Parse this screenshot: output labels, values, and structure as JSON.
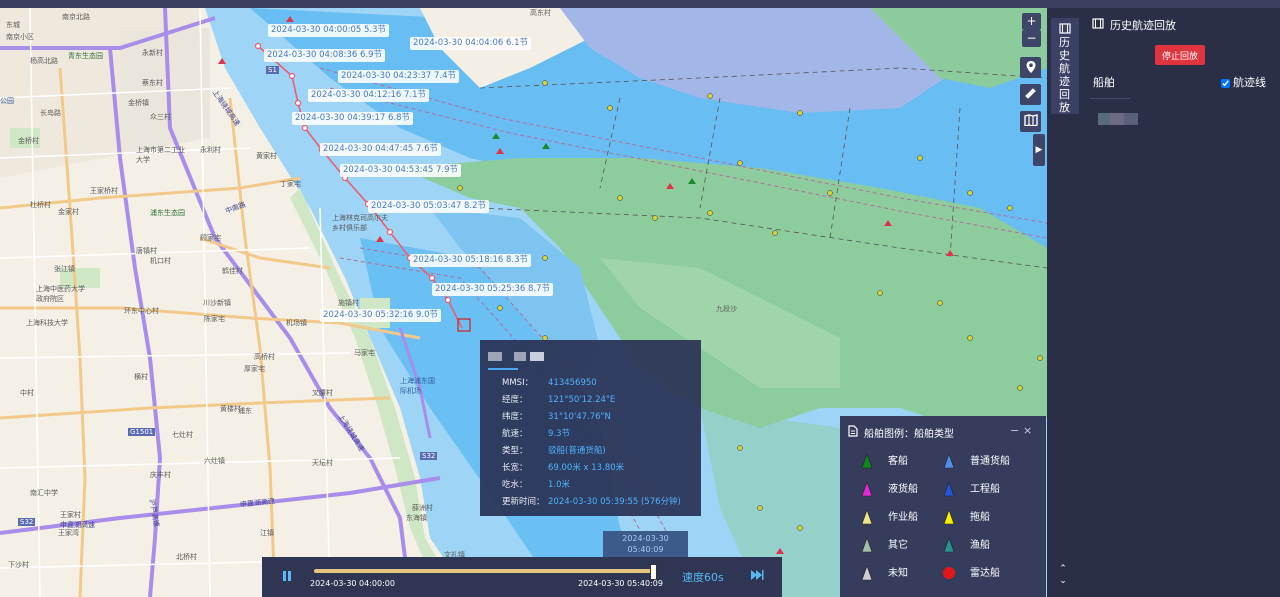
{
  "track_labels": [
    "2024-03-30 04:00:05 5.3节",
    "2024-03-30 04:04:06 6.1节",
    "2024-03-30 04:08:36 6.9节",
    "2024-03-30 04:23:37 7.4节",
    "2024-03-30 04:12:16 7.1节",
    "2024-03-30 04:39:17 6.8节",
    "2024-03-30 04:47:45 7.6节",
    "2024-03-30 04:53:45 7.9节",
    "2024-03-30 05:03:47 8.2节",
    "2024-03-30 05:18:16 8.3节",
    "2024-03-30 05:25:36 8.7节",
    "2024-03-30 05:32:16 9.0节"
  ],
  "places": {
    "p1": "东城",
    "p2": "南京北路",
    "p3": "南京小区",
    "p4": "杨高北路",
    "p5": "公园",
    "p6": "长岛路",
    "p7": "青东生态园",
    "p8": "永新村",
    "p9": "蔡东村",
    "p10": "金桥镇",
    "p11": "众三村",
    "p12": "上海市第二工业大学",
    "p13": "永利村",
    "p14": "金桥村",
    "p15": "黄家村",
    "p16": "丁家宅",
    "p17": "王家桥村",
    "p18": "杜桥村",
    "p19": "金家村",
    "p20": "浦东生态园",
    "p21": "顾家宅",
    "p22": "唐镇村",
    "p23": "机口村",
    "p24": "张江镇",
    "p25": "鹤佳村",
    "p26": "上海中医药大学政府院区",
    "p27": "川沙新镇",
    "p28": "上海科技大学",
    "p29": "环东中心村",
    "p30": "陈家宅",
    "p31": "机场镇",
    "p32": "施镇村",
    "p33": "马家宅",
    "p34": "高桥村",
    "p35": "厚家宅",
    "p36": "横村",
    "p37": "黄楼村",
    "p38": "七灶村",
    "p39": "六灶镇",
    "p40": "天坛村",
    "p41": "王家村",
    "p42": "王家湾",
    "p43": "庆丰村",
    "p44": "江镇",
    "p45": "中村",
    "p46": "东海镇",
    "p47": "薛洲村",
    "p48": "文礼镇",
    "p49": "北桥村",
    "p50": "叉腰村",
    "p51": "上海浦东国际机场",
    "p52": "九段沙",
    "p53": "上海林克司高尔夫乡村俱乐部",
    "p54": "南汇中学",
    "p55": "下沙村",
    "p56": "浦东",
    "p57": "高东村"
  },
  "roads": {
    "r1": "上海绕城高速",
    "r2": "上海绕城高速",
    "r3": "申嘉湖高速",
    "r4": "沪芦高速",
    "r5": "申嘉湖高速",
    "r6": "中南路",
    "r7": "S32",
    "r8": "S32",
    "r9": "G1501",
    "r10": "S1"
  },
  "map_controls": {
    "zoom_in": "+",
    "zoom_out": "−"
  },
  "popup": {
    "rows": [
      {
        "k": "MMSI：",
        "v": "413456950"
      },
      {
        "k": "经度：",
        "v": "121°50'12.24\"E"
      },
      {
        "k": "纬度：",
        "v": "31°10'47.76\"N"
      },
      {
        "k": "航速：",
        "v": "9.3节"
      },
      {
        "k": "类型：",
        "v": "驳船(普通货船)"
      },
      {
        "k": "长宽：",
        "v": "69.00米 x 13.80米"
      },
      {
        "k": "吃水：",
        "v": "1.0米"
      },
      {
        "k": "更新时间：",
        "v": "2024-03-30 05:39:55 (576分钟)"
      }
    ]
  },
  "legend": {
    "title": "船舶图例：船舶类型",
    "minimize": "−",
    "close": "×",
    "items": [
      {
        "label": "客船",
        "color": "#0c8a1d",
        "shape": "triangle"
      },
      {
        "label": "普通货船",
        "color": "#4f8ee8",
        "shape": "triangle"
      },
      {
        "label": "液货船",
        "color": "#e02ad6",
        "shape": "triangle"
      },
      {
        "label": "工程船",
        "color": "#2653d6",
        "shape": "triangle"
      },
      {
        "label": "作业船",
        "color": "#f0e38a",
        "shape": "triangle"
      },
      {
        "label": "拖船",
        "color": "#f7f000",
        "shape": "triangle"
      },
      {
        "label": "其它",
        "color": "#a7bca8",
        "shape": "triangle"
      },
      {
        "label": "渔船",
        "color": "#27958d",
        "shape": "triangle"
      },
      {
        "label": "未知",
        "color": "#cfcfcf",
        "shape": "triangle"
      },
      {
        "label": "雷达船",
        "color": "#e5161a",
        "shape": "circle"
      }
    ]
  },
  "playback": {
    "start_time": "2024-03-30 04:00:00",
    "end_time": "2024-03-30 05:40:09",
    "speed": "速度60s",
    "current_date": "2024-03-30",
    "current_time": "05:40:09",
    "progress": 1.0
  },
  "side_tab": {
    "label": "历史航迹回放"
  },
  "right_panel": {
    "title": "历史航迹回放",
    "stop_button": "停止回放",
    "ship_header": "船舶",
    "track_checkbox": "航迹线",
    "track_checked": true
  },
  "colors": {
    "panel_bg": "#2a2f47",
    "deep_water": "#5fb7f0",
    "shoal": "#86c9f1",
    "land_green": "#8ccb9c",
    "track_line": "#ec5d6f",
    "stop_button": "#e0343f",
    "accent_blue": "#4fb3ff"
  }
}
